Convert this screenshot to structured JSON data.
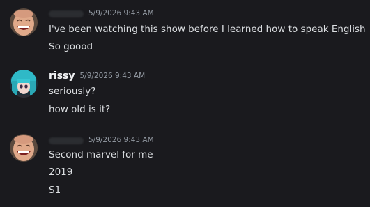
{
  "messages": [
    {
      "author": "",
      "author_redacted": true,
      "avatar": "laughing-man-avatar",
      "timestamp": "5/9/2026 9:43 AM",
      "lines": [
        "I've been watching this show before I learned how to speak English",
        "So goood"
      ]
    },
    {
      "author": "rissy",
      "author_redacted": false,
      "avatar": "teal-hair-doll-avatar",
      "timestamp": "5/9/2026 9:43 AM",
      "lines": [
        "seriously?",
        "how old is it?"
      ]
    },
    {
      "author": "",
      "author_redacted": true,
      "avatar": "laughing-man-avatar",
      "timestamp": "5/9/2026 9:43 AM",
      "lines": [
        "Second marvel for me",
        "2019",
        "S1"
      ]
    }
  ],
  "colors": {
    "background": "#1a1a1e",
    "text": "#dbdee1",
    "username": "#f2f3f5",
    "timestamp": "#949ba4"
  }
}
